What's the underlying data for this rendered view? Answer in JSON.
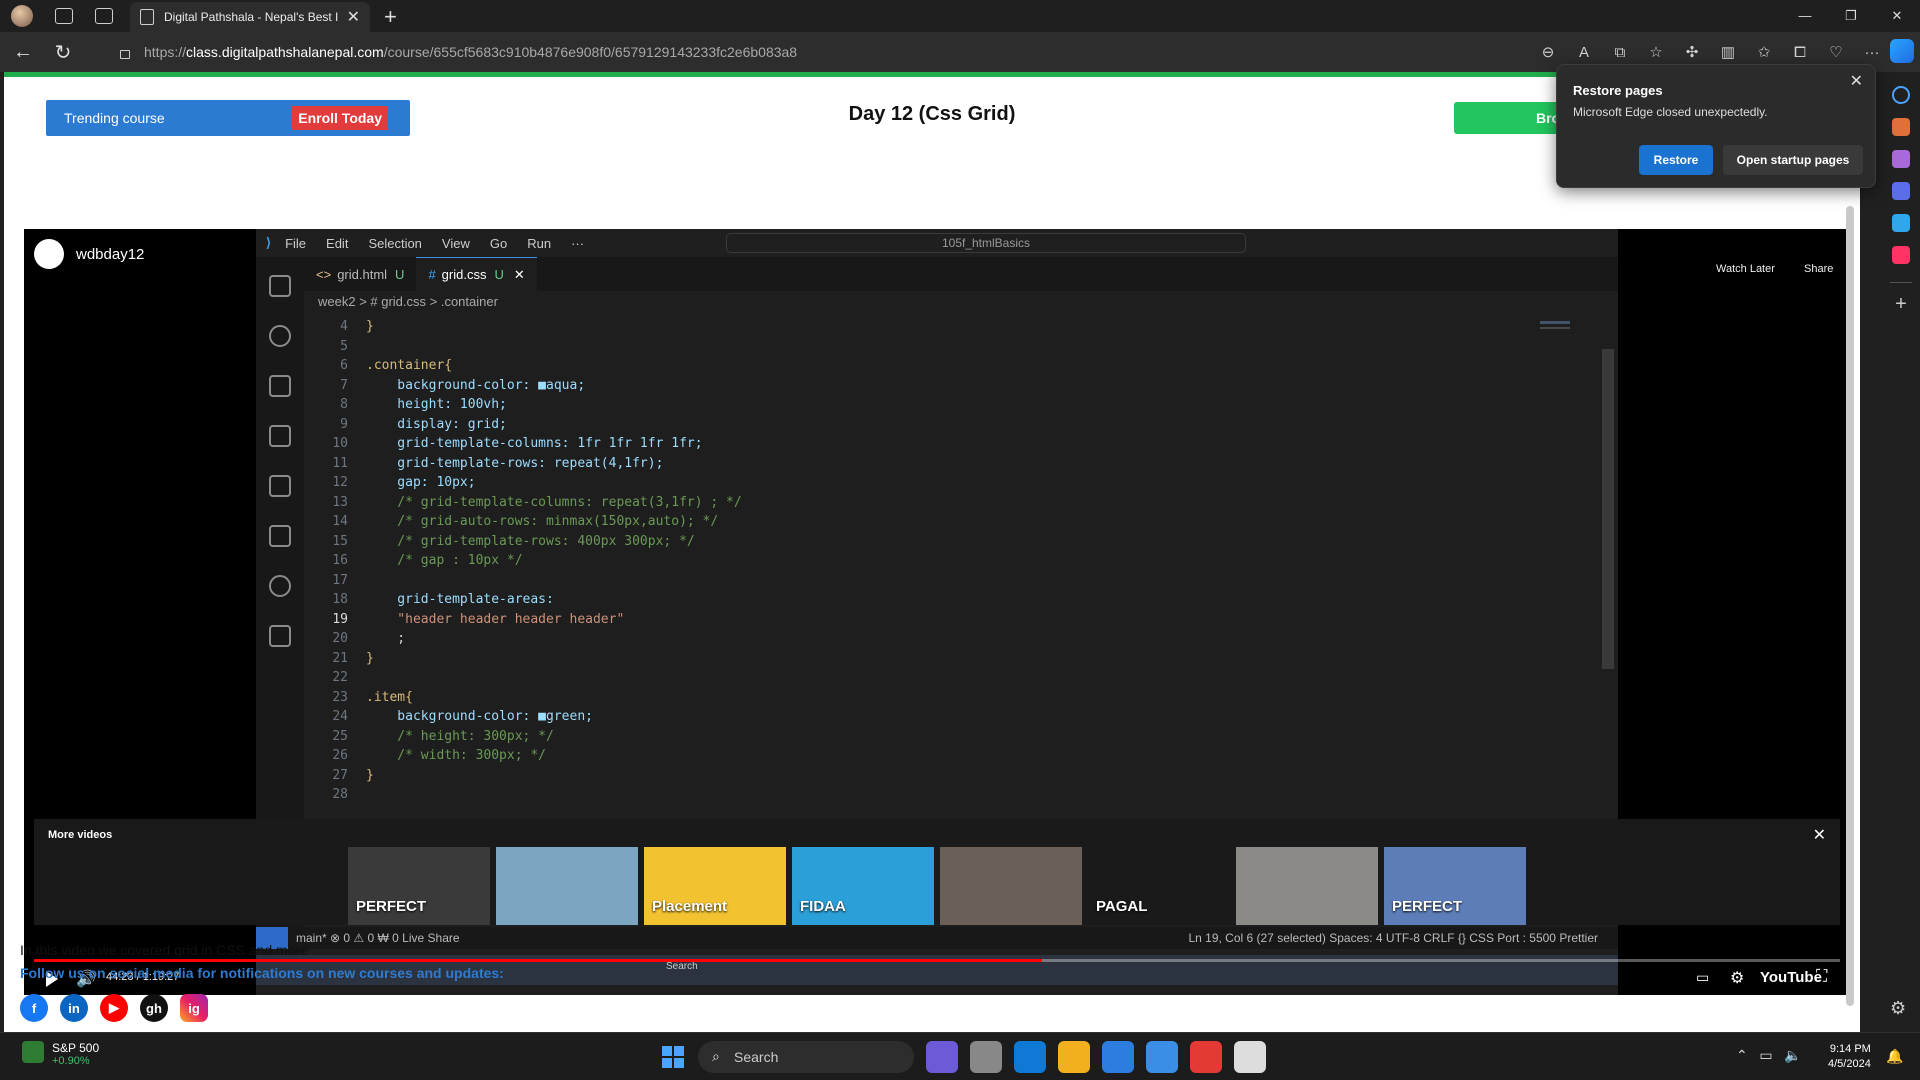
{
  "browser": {
    "tab_title": "Digital Pathshala - Nepal's Best I",
    "url_proto": "https://",
    "url_host": "class.digitalpathshalanepal.com",
    "url_path": "/course/655cf5683c910b4876e908f0/6579129143233fc2e6b083a8"
  },
  "popup": {
    "title": "Restore pages",
    "message": "Microsoft Edge closed unexpectedly.",
    "restore": "Restore",
    "startup": "Open startup pages"
  },
  "page": {
    "trending": "Trending course",
    "enroll": "Enroll Today",
    "title": "Day 12 (Css Grid)",
    "browse": "Bro",
    "description": "In this video we covered grid in CSS and more",
    "follow": "Follow us on social media for notifications on new courses and updates:",
    "social": [
      "f",
      "in",
      "▶",
      "gh",
      "ig"
    ]
  },
  "video": {
    "channel": "wdbday12",
    "watch_later": "Watch Later",
    "share": "Share",
    "time": "44:23 / 1:19:27",
    "progress": 0.558,
    "youtube": "YouTube",
    "more_videos": "More videos",
    "thumbs": [
      {
        "label": "PERFECT",
        "color": "#3a3a3a"
      },
      {
        "label": "",
        "color": "#7aa6c2"
      },
      {
        "label": "Placement",
        "color": "#f2c230"
      },
      {
        "label": "FIDAA",
        "color": "#2b9fd8"
      },
      {
        "label": "",
        "color": "#6a6058"
      },
      {
        "label": "PAGAL",
        "color": "#1a1a1a"
      },
      {
        "label": "",
        "color": "#8c8a86"
      },
      {
        "label": "PERFECT",
        "color": "#5d7db8"
      }
    ]
  },
  "vscode": {
    "menu": [
      "File",
      "Edit",
      "Selection",
      "View",
      "Go",
      "Run",
      "···"
    ],
    "search": "105f_htmlBasics",
    "tabs": [
      {
        "tag": "<>",
        "name": "grid.html",
        "mod": "U"
      },
      {
        "tag": "#",
        "name": "grid.css",
        "mod": "U"
      }
    ],
    "breadcrumb": "week2 > # grid.css > .container",
    "lines": [
      {
        "n": "4",
        "code": "}"
      },
      {
        "n": "5",
        "code": ""
      },
      {
        "n": "6",
        "code": ".container{"
      },
      {
        "n": "7",
        "code": "    background-color: ■aqua;"
      },
      {
        "n": "8",
        "code": "    height: 100vh;"
      },
      {
        "n": "9",
        "code": "    display: grid;"
      },
      {
        "n": "10",
        "code": "    grid-template-columns: 1fr 1fr 1fr 1fr;"
      },
      {
        "n": "11",
        "code": "    grid-template-rows: repeat(4,1fr);"
      },
      {
        "n": "12",
        "code": "    gap: 10px;"
      },
      {
        "n": "13",
        "code": "    /* grid-template-columns: repeat(3,1fr) ; */"
      },
      {
        "n": "14",
        "code": "    /* grid-auto-rows: minmax(150px,auto); */"
      },
      {
        "n": "15",
        "code": "    /* grid-template-rows: 400px 300px; */"
      },
      {
        "n": "16",
        "code": "    /* gap : 10px */"
      },
      {
        "n": "17",
        "code": ""
      },
      {
        "n": "18",
        "code": "    grid-template-areas:"
      },
      {
        "n": "19",
        "code": "    \"header header header header\""
      },
      {
        "n": "20",
        "code": "    ;"
      },
      {
        "n": "21",
        "code": "}"
      },
      {
        "n": "22",
        "code": ""
      },
      {
        "n": "23",
        "code": ".item{"
      },
      {
        "n": "24",
        "code": "    background-color: ■green;"
      },
      {
        "n": "25",
        "code": "    /* height: 300px; */"
      },
      {
        "n": "26",
        "code": "    /* width: 300px; */"
      },
      {
        "n": "27",
        "code": "}"
      },
      {
        "n": "28",
        "code": ""
      }
    ],
    "status_left": "main*   ⊗ 0 ⚠ 0   ₩ 0   Live Share",
    "status_right": "Ln 19, Col 6 (27 selected)   Spaces: 4   UTF-8   CRLF   {} CSS   Port : 5500   Prettier",
    "inner_task": "Search"
  },
  "taskbar": {
    "ticker_name": "S&P 500",
    "ticker_value": "+0.90%",
    "search": "Search",
    "time": "9:14 PM",
    "date": "4/5/2024",
    "apps": [
      "#6b5bd6",
      "#888888",
      "#0f7ad6",
      "#f2b01e",
      "#2d7de0",
      "#3a8ee6",
      "#e53935",
      "#dddddd"
    ]
  }
}
